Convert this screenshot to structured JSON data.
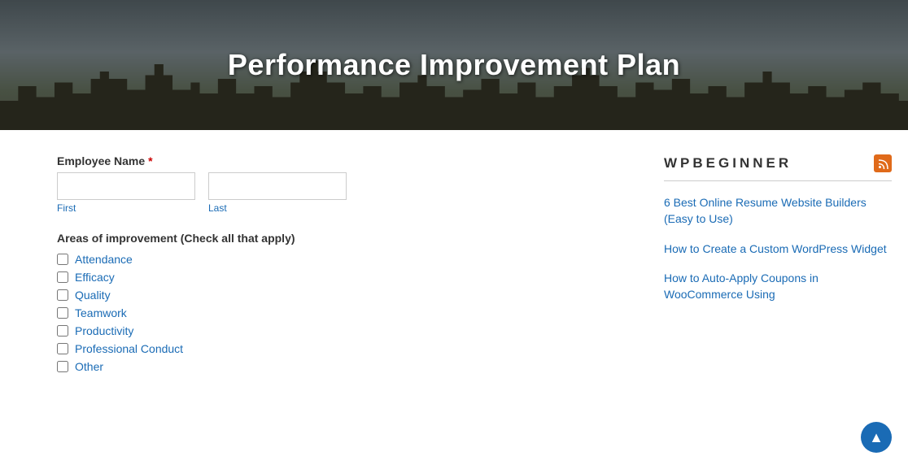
{
  "header": {
    "title": "Performance Improvement Plan"
  },
  "form": {
    "employee_name_label": "Employee Name",
    "required_marker": "*",
    "first_label": "First",
    "last_label": "Last",
    "areas_label": "Areas of improvement (Check all that apply)",
    "checkboxes": [
      {
        "id": "cb_attendance",
        "label": "Attendance"
      },
      {
        "id": "cb_efficacy",
        "label": "Efficacy"
      },
      {
        "id": "cb_quality",
        "label": "Quality"
      },
      {
        "id": "cb_teamwork",
        "label": "Teamwork"
      },
      {
        "id": "cb_productivity",
        "label": "Productivity"
      },
      {
        "id": "cb_professional",
        "label": "Professional Conduct"
      },
      {
        "id": "cb_other",
        "label": "Other"
      }
    ]
  },
  "sidebar": {
    "brand": "WPBEGINNER",
    "rss_icon": "rss",
    "links": [
      {
        "id": "link1",
        "text": "6 Best Online Resume Website Builders (Easy to Use)"
      },
      {
        "id": "link2",
        "text": "How to Create a Custom WordPress Widget"
      },
      {
        "id": "link3",
        "text": "How to Auto-Apply Coupons in WooCommerce Using"
      }
    ]
  },
  "scroll_top": {
    "icon": "▲"
  }
}
